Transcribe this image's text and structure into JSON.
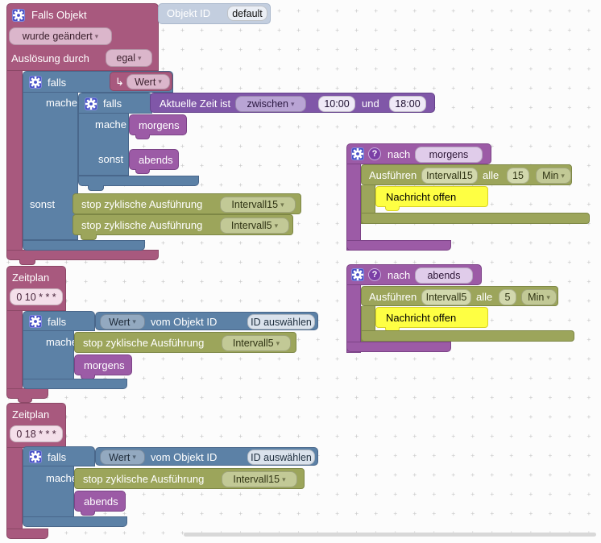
{
  "icons": {
    "dropdown_arrow": "▾",
    "hook_arrow": "↳",
    "question_glyph": "?"
  },
  "colors": {
    "workspace_grid": "#C9C9C9",
    "trigger_block": "#A8597E",
    "logic_block": "#5C81A6",
    "time_block": "#8057A8",
    "procedure_block": "#9C5BA6",
    "action_block": "#9CA55B",
    "object_id_block": "#C3CEDF",
    "comment_block": "#FEFF43",
    "gear_icon_bg": "#4650C8"
  },
  "common": {
    "falls": "falls",
    "mache": "mache",
    "sonst": "sonst",
    "stop_label": "stop zyklische Ausführung",
    "wert": "Wert",
    "vom_objekt_id": "vom Objekt ID",
    "id_auswaehlen": "ID auswählen",
    "nach": "nach",
    "ausfuehren": "Ausführen",
    "alle": "alle",
    "min": "Min",
    "nachricht_offen": "Nachricht offen",
    "und": "und",
    "zeitplan": "Zeitplan",
    "morgens": "morgens",
    "abends": "abends"
  },
  "trigger": {
    "title": "Falls Objekt",
    "object_label": "Objekt ID",
    "object_value": "default",
    "change_mode": "wurde geändert",
    "trigger_by_label": "Auslösung durch",
    "trigger_by_value": "egal"
  },
  "time_condition": {
    "label": "Aktuelle Zeit ist",
    "mode": "zwischen",
    "from": "10:00",
    "to": "18:00"
  },
  "sonst_branch": {
    "stop_interval_first": "Intervall15",
    "stop_interval_second": "Intervall5"
  },
  "exec_morgens": {
    "interval": "Intervall15",
    "every": "15"
  },
  "exec_abends": {
    "interval": "Intervall5",
    "every": "5"
  },
  "zeitplan1": {
    "cron": "0 10 * * *",
    "stop_interval": "Intervall5"
  },
  "zeitplan2": {
    "cron": "0 18 * * *",
    "stop_interval": "Intervall15"
  }
}
